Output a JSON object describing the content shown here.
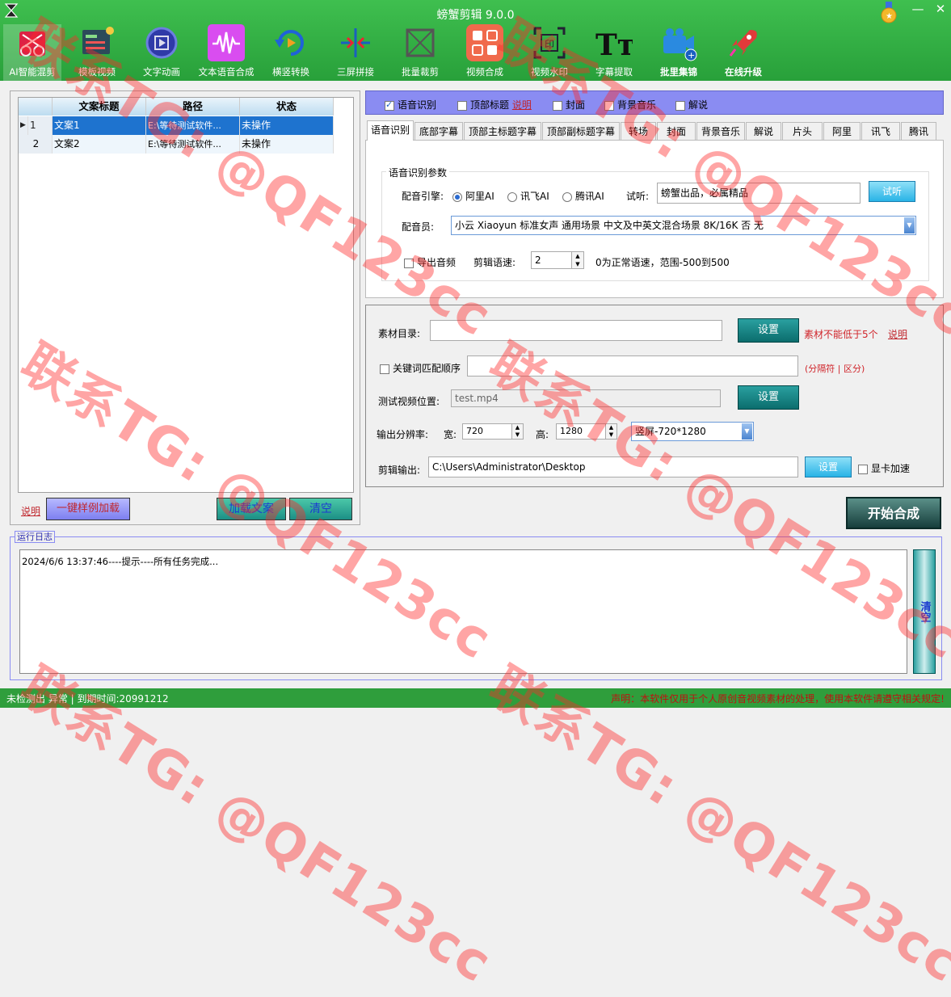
{
  "app": {
    "title": "螃蟹剪辑 9.0.0"
  },
  "toolbar": {
    "items": [
      {
        "label": "AI智能混剪",
        "icon": "ai-mix-icon"
      },
      {
        "label": "模板视频",
        "icon": "template-video-icon"
      },
      {
        "label": "文字动画",
        "icon": "text-animation-icon"
      },
      {
        "label": "文本语音合成",
        "icon": "tts-wave-icon"
      },
      {
        "label": "横竖转换",
        "icon": "rotate-convert-icon"
      },
      {
        "label": "三屏拼接",
        "icon": "three-screen-icon"
      },
      {
        "label": "批量裁剪",
        "icon": "batch-crop-icon"
      },
      {
        "label": "视频合成",
        "icon": "video-compose-icon"
      },
      {
        "label": "视频水印",
        "icon": "watermark-icon"
      },
      {
        "label": "字幕提取",
        "icon": "subtitle-extract-icon"
      },
      {
        "label": "批里集锦",
        "icon": "camera-icon"
      },
      {
        "label": "在线升级",
        "icon": "rocket-icon"
      }
    ]
  },
  "grid": {
    "headers": [
      "文案标题",
      "路径",
      "状态"
    ],
    "rows": [
      {
        "num": "1",
        "title": "文案1",
        "path": "E:\\等待测试软件...",
        "status": "未操作"
      },
      {
        "num": "2",
        "title": "文案2",
        "path": "E:\\等待测试软件...",
        "status": "未操作"
      }
    ]
  },
  "left_actions": {
    "explain": "说明",
    "load_sample": "一键样例加载",
    "load_text": "加载文案",
    "clear": "清空"
  },
  "top_options": [
    {
      "label": "语音识别",
      "checked": true
    },
    {
      "label": "顶部标题",
      "checked": false
    },
    {
      "label": "封面",
      "checked": false
    },
    {
      "label": "背景音乐",
      "checked": false
    },
    {
      "label": "解说",
      "checked": false
    }
  ],
  "top_explain": "说明",
  "tabs": [
    "语音识别",
    "底部字幕",
    "顶部主标题字幕",
    "顶部副标题字幕",
    "转场",
    "封面",
    "背景音乐",
    "解说",
    "片头",
    "阿里",
    "讯飞",
    "腾讯"
  ],
  "speech": {
    "group_title": "语音识别参数",
    "engine_label": "配音引擎:",
    "engines": [
      {
        "label": "阿里AI",
        "selected": true
      },
      {
        "label": "讯飞AI",
        "selected": false
      },
      {
        "label": "腾讯AI",
        "selected": false
      }
    ],
    "preview_label": "试听:",
    "preview_text": "螃蟹出品，必属精品",
    "preview_button": "试听",
    "voice_label": "配音员:",
    "voice_value": "小云 Xiaoyun 标准女声 通用场景 中文及中英文混合场景 8K/16K 否 无",
    "export_audio": "导出音频",
    "speed_label": "剪辑语速:",
    "speed_value": "2",
    "speed_hint": "0为正常语速，范围-500到500"
  },
  "material": {
    "dir_label": "素材目录:",
    "dir_value": "",
    "set_button": "设置",
    "warn": "素材不能低于5个",
    "explain": "说明",
    "keyword_label": "关键词匹配顺序",
    "keyword_value": "",
    "keyword_hint": "(分隔符 | 区分)",
    "test_label": "测试视频位置:",
    "test_value": "test.mp4",
    "test_button": "设置",
    "res_label": "输出分辨率:",
    "width_label": "宽:",
    "width_value": "720",
    "height_label": "高:",
    "height_value": "1280",
    "preset_value": "竖屏-720*1280",
    "output_label": "剪辑输出:",
    "output_value": "C:\\Users\\Administrator\\Desktop",
    "output_button": "设置",
    "gpu_label": "显卡加速"
  },
  "start_button": "开始合成",
  "log": {
    "title": "运行日志",
    "lines": [
      "2024/6/6 13:37:46----提示----所有任务完成..."
    ],
    "clear_button": "清空"
  },
  "status": {
    "left": "未检测出 异常 | 到期时间:20991212",
    "right": "声明：本软件仅用于个人原创音视频素材的处理，使用本软件请遵守相关规定!"
  },
  "watermark": "联系TG: @QF123cc"
}
